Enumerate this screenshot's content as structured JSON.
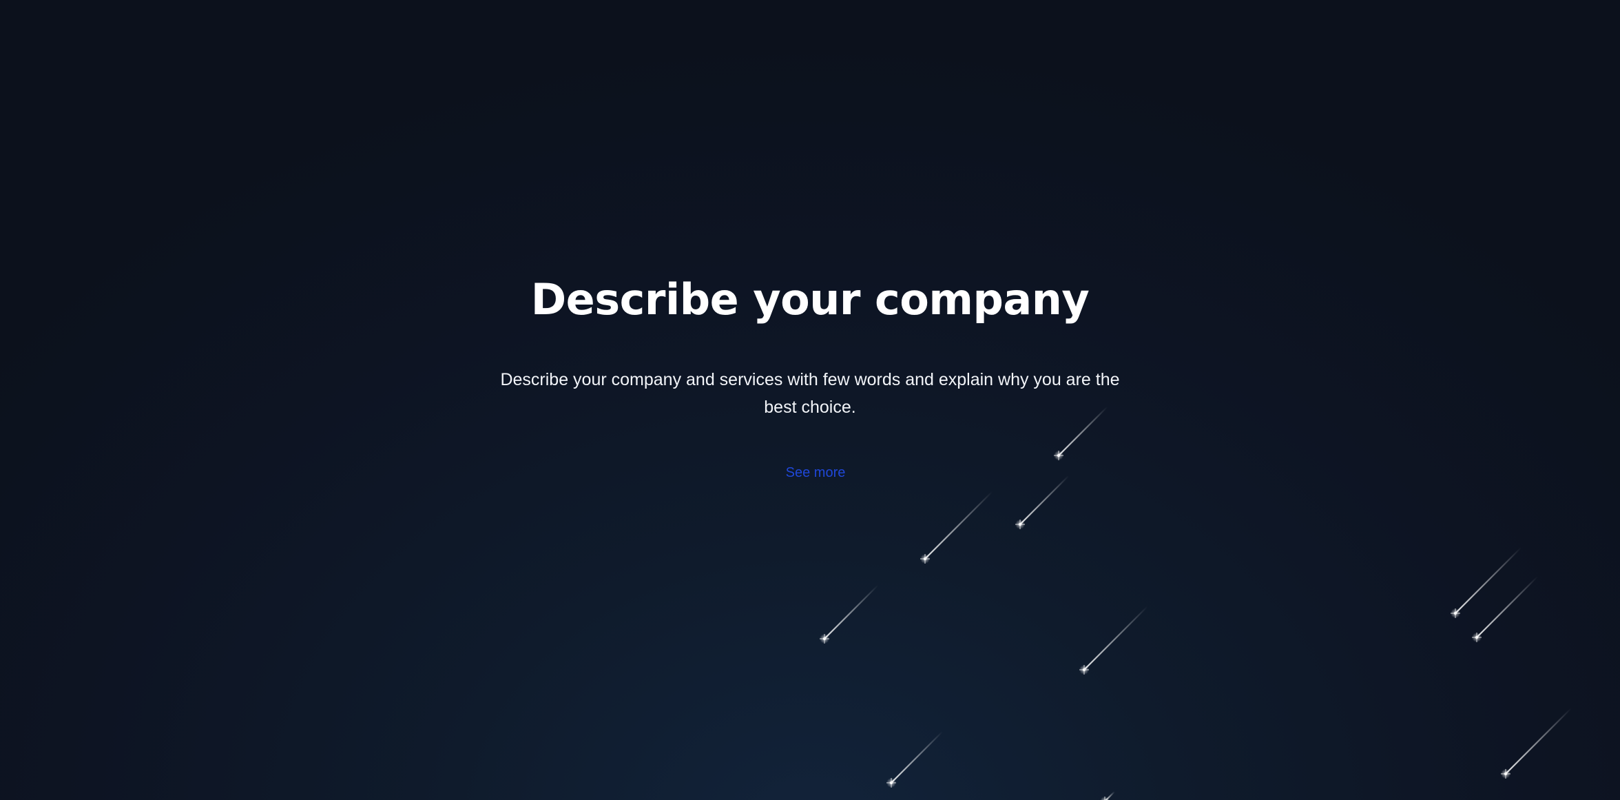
{
  "hero": {
    "title": "Describe your company",
    "subtitle": "Describe your company and services with few words and explain why you are the best choice.",
    "link_label": "See more"
  },
  "colors": {
    "background": "#0d1320",
    "title": "#ffffff",
    "link": "#1f47d8",
    "meteor": "#ffffff"
  },
  "decoration": {
    "icon": "shooting-star-icon"
  }
}
